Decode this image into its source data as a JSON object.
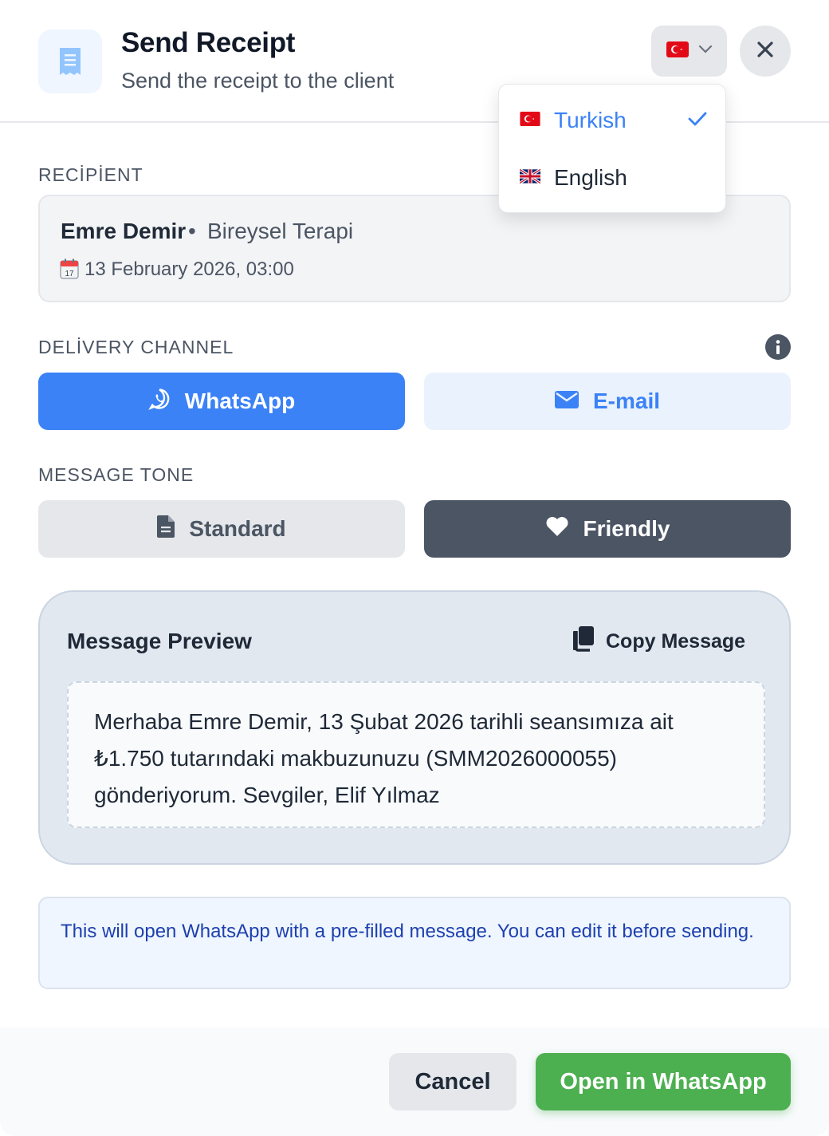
{
  "header": {
    "title": "Send Receipt",
    "subtitle": "Send the receipt to the client",
    "icon": "receipt-icon",
    "language_flag": "turkey-flag-icon"
  },
  "language_menu": {
    "items": [
      {
        "label": "Turkish",
        "flag": "turkey-flag-icon",
        "selected": true
      },
      {
        "label": "English",
        "flag": "uk-flag-icon",
        "selected": false
      }
    ]
  },
  "recipient": {
    "section_label": "RECİPİENT",
    "name": "Emre Demir",
    "separator": "•",
    "service": "Bireysel Terapi",
    "date": "13 February 2026, 03:00"
  },
  "delivery": {
    "section_label": "DELİVERY CHANNEL",
    "options": [
      {
        "label": "WhatsApp",
        "icon": "whatsapp-icon",
        "active": true
      },
      {
        "label": "E-mail",
        "icon": "mail-icon",
        "active": false
      }
    ]
  },
  "tone": {
    "section_label": "MESSAGE TONE",
    "options": [
      {
        "label": "Standard",
        "icon": "document-icon",
        "active": false
      },
      {
        "label": "Friendly",
        "icon": "heart-icon",
        "active": true
      }
    ]
  },
  "preview": {
    "title": "Message Preview",
    "copy_label": "Copy Message",
    "message": "Merhaba Emre Demir, 13 Şubat 2026 tarihli seansımıza ait ₺1.750 tutarındaki makbuzunuzu (SMM2026000055) gönderiyorum. Sevgiler, Elif Yılmaz"
  },
  "notice": {
    "text": "This will open WhatsApp with a pre-filled message. You can edit it before sending."
  },
  "footer": {
    "cancel_label": "Cancel",
    "open_label": "Open in WhatsApp"
  },
  "colors": {
    "primary": "#3b82f6",
    "success": "#4caf50",
    "dark": "#4b5563"
  }
}
